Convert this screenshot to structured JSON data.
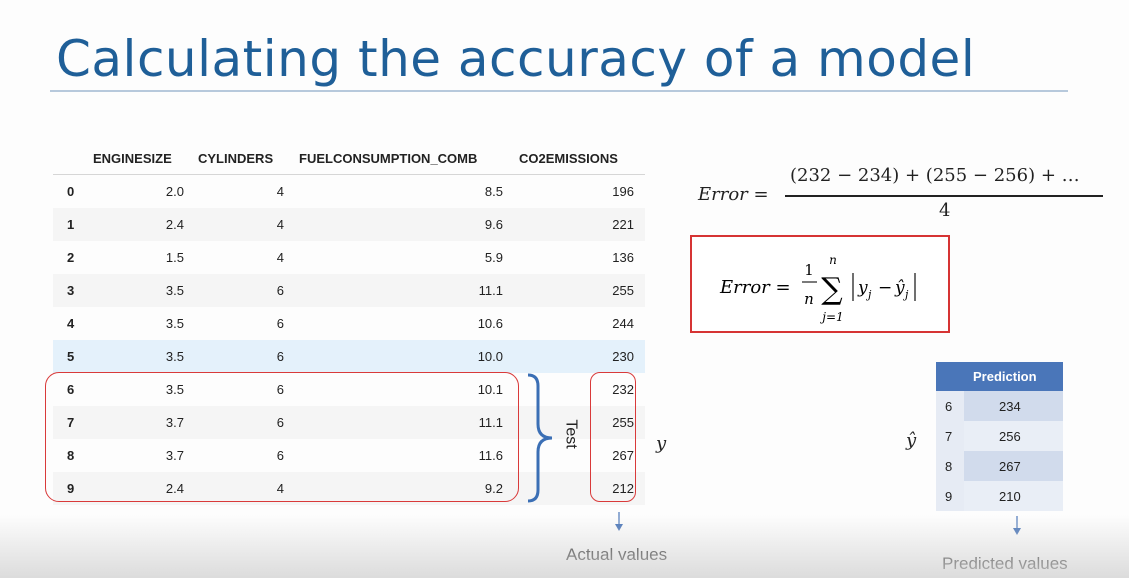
{
  "slide": {
    "title": "Calculating the accuracy of a model"
  },
  "data_table": {
    "columns": [
      "ENGINESIZE",
      "CYLINDERS",
      "FUELCONSUMPTION_COMB",
      "CO2EMISSIONS"
    ],
    "rows": [
      {
        "idx": "0",
        "enginesize": "2.0",
        "cylinders": "4",
        "fuel": "8.5",
        "co2": "196"
      },
      {
        "idx": "1",
        "enginesize": "2.4",
        "cylinders": "4",
        "fuel": "9.6",
        "co2": "221"
      },
      {
        "idx": "2",
        "enginesize": "1.5",
        "cylinders": "4",
        "fuel": "5.9",
        "co2": "136"
      },
      {
        "idx": "3",
        "enginesize": "3.5",
        "cylinders": "6",
        "fuel": "11.1",
        "co2": "255"
      },
      {
        "idx": "4",
        "enginesize": "3.5",
        "cylinders": "6",
        "fuel": "10.6",
        "co2": "244"
      },
      {
        "idx": "5",
        "enginesize": "3.5",
        "cylinders": "6",
        "fuel": "10.0",
        "co2": "230"
      },
      {
        "idx": "6",
        "enginesize": "3.5",
        "cylinders": "6",
        "fuel": "10.1",
        "co2": "232"
      },
      {
        "idx": "7",
        "enginesize": "3.7",
        "cylinders": "6",
        "fuel": "11.1",
        "co2": "255"
      },
      {
        "idx": "8",
        "enginesize": "3.7",
        "cylinders": "6",
        "fuel": "11.6",
        "co2": "267"
      },
      {
        "idx": "9",
        "enginesize": "2.4",
        "cylinders": "4",
        "fuel": "9.2",
        "co2": "212"
      }
    ],
    "highlighted_row": "5",
    "test_label": "Test",
    "y_label": "y",
    "actual_label": "Actual values"
  },
  "formulas": {
    "error_example": {
      "lhs": "Error =",
      "numerator": "(232 − 234) + (255 − 256) + …",
      "denominator": "4"
    },
    "error_mae": {
      "lhs": "Error =",
      "frac_num": "1",
      "frac_den": "n",
      "sum_upper": "n",
      "sum_lower": "j=1",
      "sigma": "∑",
      "body_y": "y",
      "body_yhat": "ŷ",
      "subscript": "j",
      "minus": "−"
    }
  },
  "prediction_table": {
    "header": "Prediction",
    "rows": [
      {
        "idx": "6",
        "value": "234"
      },
      {
        "idx": "7",
        "value": "256"
      },
      {
        "idx": "8",
        "value": "267"
      },
      {
        "idx": "9",
        "value": "210"
      }
    ],
    "yhat_label": "ŷ",
    "predicted_label": "Predicted values"
  },
  "colors": {
    "title": "#1f5f98",
    "highlight_box": "#d93a3a",
    "brace": "#3b6fb5",
    "prediction_header": "#4a76b9",
    "arrow": "#4a76b9"
  },
  "icons": {
    "down_arrow": "arrow-down-icon",
    "brace": "curly-brace-icon"
  }
}
